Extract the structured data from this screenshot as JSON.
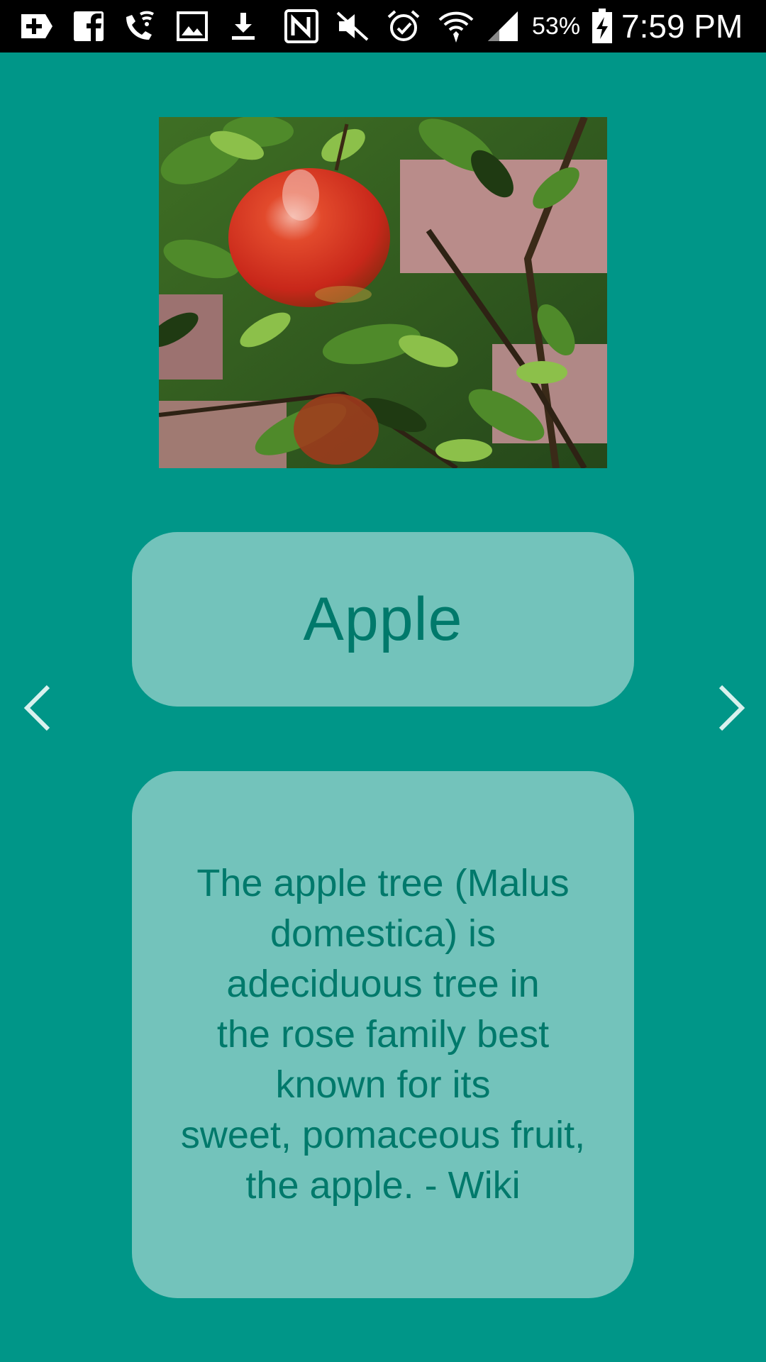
{
  "status_bar": {
    "icons": [
      "add-box-icon",
      "facebook-icon",
      "wifi-call-icon",
      "image-icon",
      "download-icon",
      "nfc-icon",
      "mute-icon",
      "alarm-icon",
      "wifi-icon",
      "signal-icon",
      "battery-charging-icon"
    ],
    "battery": "53%",
    "time": "7:59 PM"
  },
  "fruit": {
    "image_icon": "apple-photo",
    "name": "Apple",
    "description": "The apple tree (Malus\ndomestica) is\nadeciduous tree in\nthe rose family best\nknown for its\nsweet, pomaceous fruit,\nthe apple. - Wiki"
  },
  "nav": {
    "prev_icon": "chevron-left-icon",
    "next_icon": "chevron-right-icon"
  },
  "colors": {
    "background": "#009688",
    "card": "#73c3bb",
    "card_text": "#00796b",
    "status_bar": "#000000",
    "arrow": "#ffffff"
  }
}
